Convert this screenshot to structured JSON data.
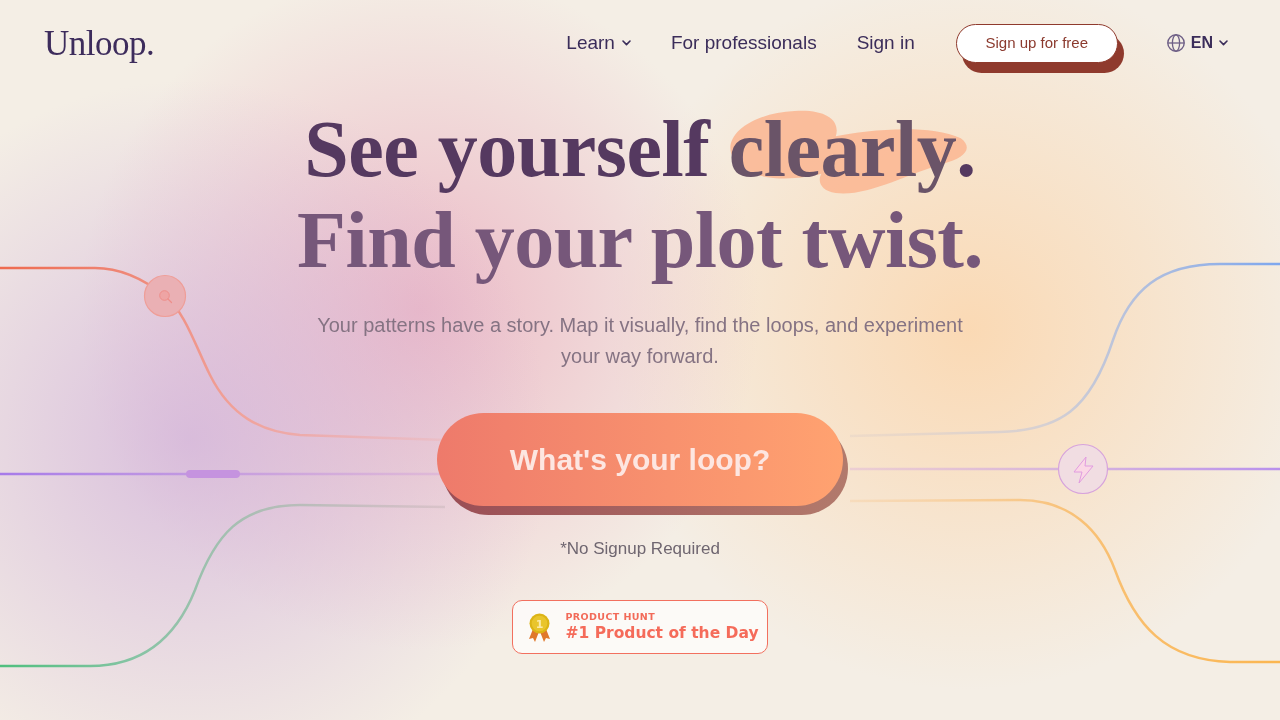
{
  "header": {
    "logo": "Unloop.",
    "nav": [
      {
        "label": "Learn",
        "kind": "dropdown"
      },
      {
        "label": "For professionals",
        "kind": "link"
      },
      {
        "label": "Sign in",
        "kind": "link"
      }
    ],
    "signup_button": "Sign up for free",
    "language": "EN"
  },
  "hero": {
    "headline": [
      {
        "segments": [
          {
            "text": "See yourself ",
            "highlighted": false
          },
          {
            "text": "clearly",
            "highlighted": true
          },
          {
            "text": ".",
            "highlighted": false
          }
        ]
      },
      {
        "segments": [
          {
            "text": "Find your plot twist.",
            "highlighted": false
          }
        ]
      }
    ],
    "subtitle": "Your patterns have a story. Map it visually, find the loops, and experiment your way forward.",
    "cta_button": "What's your loop?",
    "note": "*No Signup Required",
    "badge": {
      "rank": "1",
      "label": "PRODUCT HUNT",
      "title": "#1 Product of the Day"
    }
  }
}
